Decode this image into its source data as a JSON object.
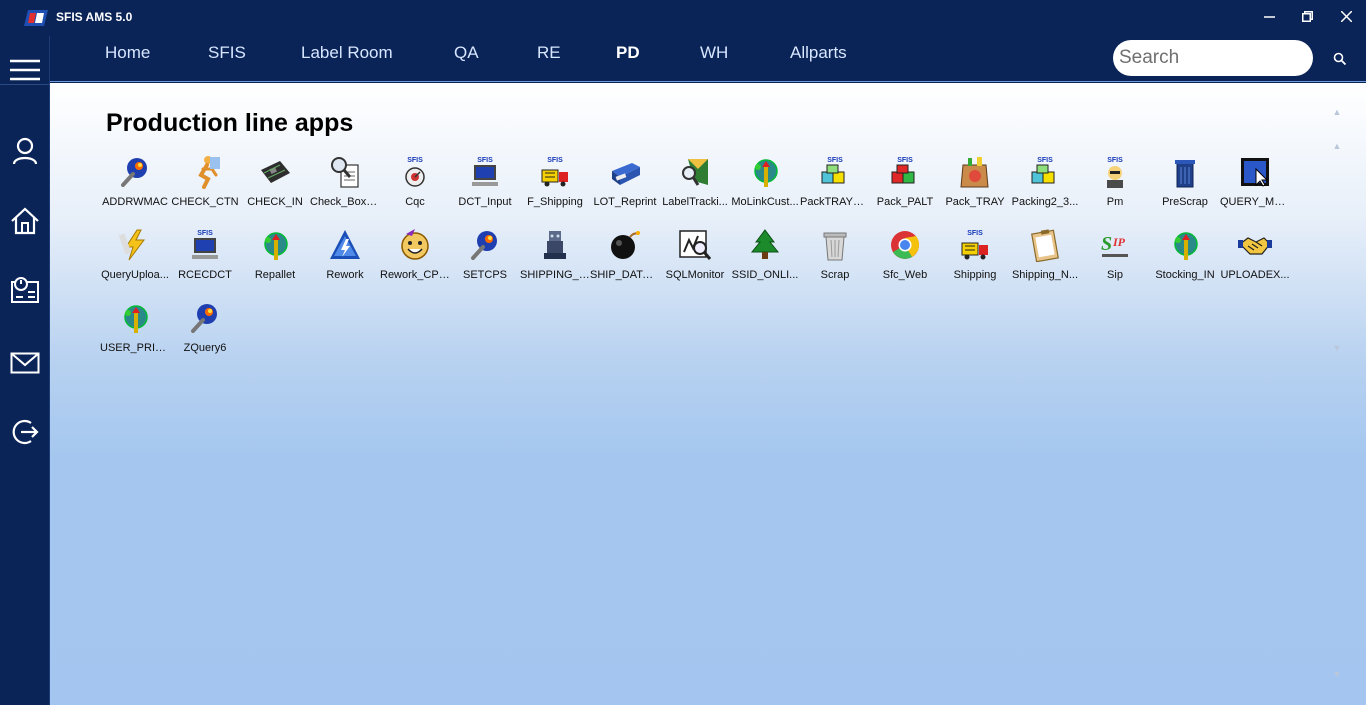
{
  "window": {
    "title": "SFIS AMS 5.0"
  },
  "nav": {
    "tabs": [
      {
        "label": "Home"
      },
      {
        "label": "SFIS"
      },
      {
        "label": "Label Room"
      },
      {
        "label": "QA"
      },
      {
        "label": "RE"
      },
      {
        "label": "PD",
        "active": true
      },
      {
        "label": "WH"
      },
      {
        "label": "Allparts"
      }
    ],
    "search_placeholder": "Search"
  },
  "sidebar": {
    "items": [
      {
        "icon": "menu-icon"
      },
      {
        "icon": "user-icon"
      },
      {
        "icon": "home-icon"
      },
      {
        "icon": "dashboard-icon"
      },
      {
        "icon": "mail-icon"
      },
      {
        "icon": "logout-icon"
      }
    ]
  },
  "content": {
    "title": "Production line apps",
    "apps": [
      {
        "label": "ADDRWMAC",
        "icon": "torch-icon"
      },
      {
        "label": "CHECK_CTN",
        "icon": "runner-icon"
      },
      {
        "label": "CHECK_IN",
        "icon": "circuit-board-icon"
      },
      {
        "label": "Check_Box_...",
        "icon": "magnifier-document-icon"
      },
      {
        "label": "Cqc",
        "icon": "sfis-gauge-icon"
      },
      {
        "label": "DCT_Input",
        "icon": "sfis-monitor-icon"
      },
      {
        "label": "F_Shipping",
        "icon": "sfis-truck-icon"
      },
      {
        "label": "LOT_Reprint",
        "icon": "printer-icon"
      },
      {
        "label": "LabelTracki...",
        "icon": "label-magnifier-icon"
      },
      {
        "label": "MoLinkCust...",
        "icon": "olympic-torch-icon"
      },
      {
        "label": "PackTRAY_C...",
        "icon": "sfis-boxes-icon"
      },
      {
        "label": "Pack_PALT",
        "icon": "sfis-boxes-red-icon"
      },
      {
        "label": "Pack_TRAY",
        "icon": "grocery-bag-icon"
      },
      {
        "label": "Packing2_3...",
        "icon": "sfis-boxes-icon"
      },
      {
        "label": "Pm",
        "icon": "sfis-person-icon"
      },
      {
        "label": "PreScrap",
        "icon": "trash-can-icon"
      },
      {
        "label": "QUERY_MO...",
        "icon": "window-cursor-icon"
      },
      {
        "label": "QueryUploa...",
        "icon": "lightning-icon"
      },
      {
        "label": "RCECDCT",
        "icon": "sfis-monitor-icon"
      },
      {
        "label": "Repallet",
        "icon": "olympic-torch-icon"
      },
      {
        "label": "Rework",
        "icon": "warning-triangle-icon"
      },
      {
        "label": "Rework_CPEII",
        "icon": "smiley-icon"
      },
      {
        "label": "SETCPS",
        "icon": "torch-icon"
      },
      {
        "label": "SHIPPING_L...",
        "icon": "robot-icon"
      },
      {
        "label": "SHIP_DATA_...",
        "icon": "bomb-icon"
      },
      {
        "label": "SQLMonitor",
        "icon": "sql-magnifier-icon"
      },
      {
        "label": "SSID_ONLI...",
        "icon": "pine-tree-icon"
      },
      {
        "label": "Scrap",
        "icon": "trash-bin-icon"
      },
      {
        "label": "Sfc_Web",
        "icon": "chrome-icon"
      },
      {
        "label": "Shipping",
        "icon": "sfis-truck-icon"
      },
      {
        "label": "Shipping_N...",
        "icon": "clipboard-icon"
      },
      {
        "label": "Sip",
        "icon": "sip-logo-icon"
      },
      {
        "label": "Stocking_IN",
        "icon": "olympic-torch-icon"
      },
      {
        "label": "UPLOADEX...",
        "icon": "handshake-icon"
      },
      {
        "label": "USER_PRIVI...",
        "icon": "olympic-torch-icon"
      },
      {
        "label": "ZQuery6",
        "icon": "torch-icon"
      }
    ]
  },
  "colors": {
    "frame": "#0a2457",
    "accent": "#6e9bd8",
    "content_top": "#ffffff",
    "content_bottom": "#a3c5ef"
  }
}
